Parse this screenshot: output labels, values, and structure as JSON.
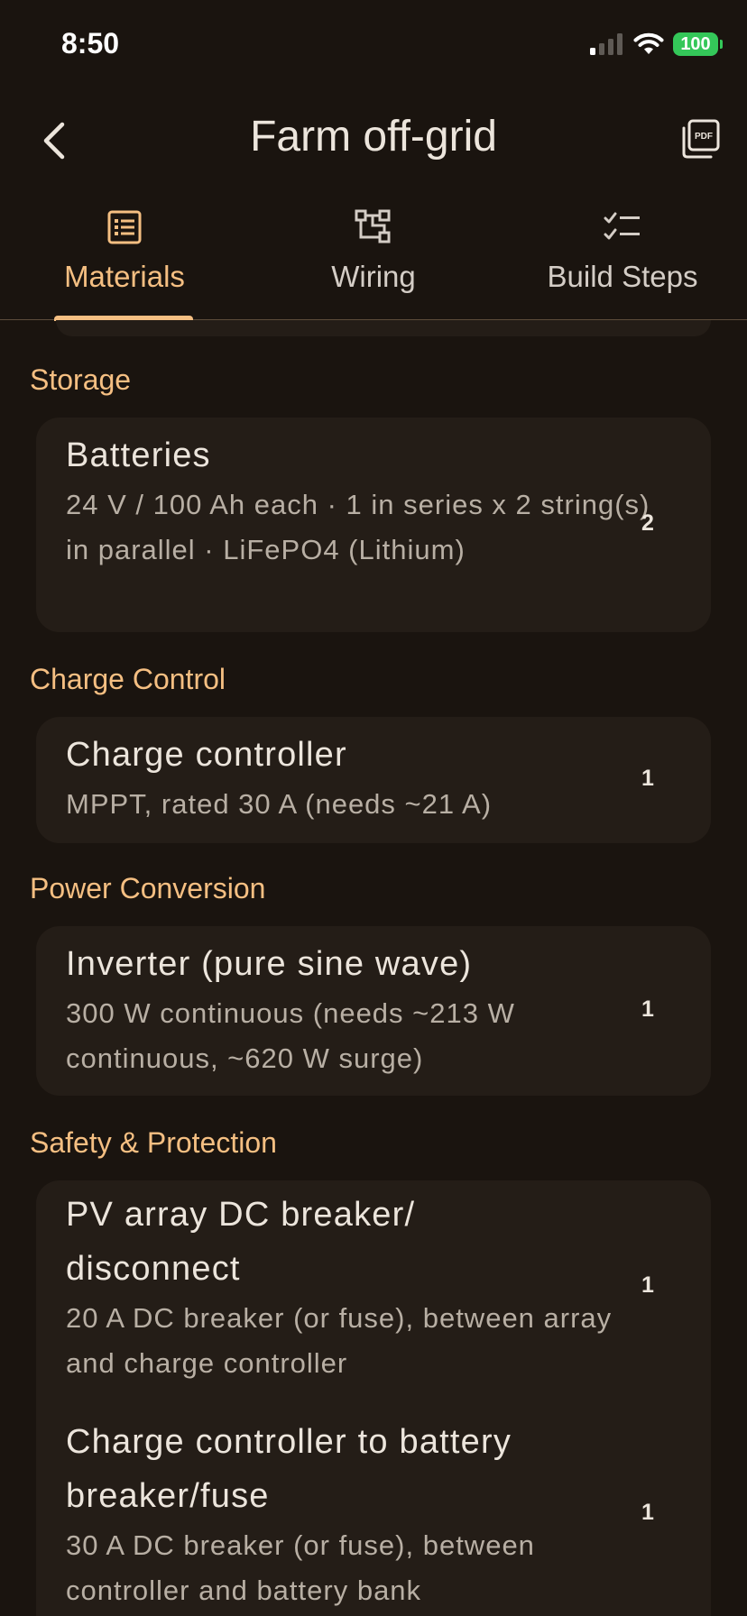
{
  "status_bar": {
    "time": "8:50",
    "battery": "100",
    "icons": [
      "cellular-signal-icon",
      "wifi-icon",
      "battery-icon"
    ]
  },
  "header": {
    "title": "Farm off-grid",
    "back_icon": "chevron-left-icon",
    "export_icon": "pdf-icon"
  },
  "tabs": [
    {
      "label": "Materials",
      "icon": "list-icon",
      "active": true
    },
    {
      "label": "Wiring",
      "icon": "wiring-diagram-icon",
      "active": false
    },
    {
      "label": "Build Steps",
      "icon": "checklist-icon",
      "active": false
    }
  ],
  "colors": {
    "background": "#1a140f",
    "card": "#241d17",
    "accent": "#f5bf82",
    "text": "#ece5dc",
    "muted_text": "#b8afa4",
    "battery": "#34c759"
  },
  "sections": [
    {
      "title": "Storage",
      "items": [
        {
          "name": "Batteries",
          "description": "24 V / 100 Ah each · 1 in series x 2 string(s) in parallel · LiFePO4 (Lithium)",
          "qty": "2"
        }
      ]
    },
    {
      "title": "Charge Control",
      "items": [
        {
          "name": "Charge controller",
          "description": "MPPT, rated 30 A (needs ~21 A)",
          "qty": "1"
        }
      ]
    },
    {
      "title": "Power Conversion",
      "items": [
        {
          "name": "Inverter (pure sine wave)",
          "description": "300 W continuous (needs ~213 W continuous, ~620 W surge)",
          "qty": "1"
        }
      ]
    },
    {
      "title": "Safety & Protection",
      "items": [
        {
          "name": "PV array DC breaker/ disconnect",
          "description": "20 A DC breaker (or fuse), between array and charge controller",
          "qty": "1"
        },
        {
          "name": "Charge controller to battery breaker/fuse",
          "description": "30 A DC breaker (or fuse), between controller and battery bank",
          "qty": "1"
        }
      ]
    }
  ]
}
